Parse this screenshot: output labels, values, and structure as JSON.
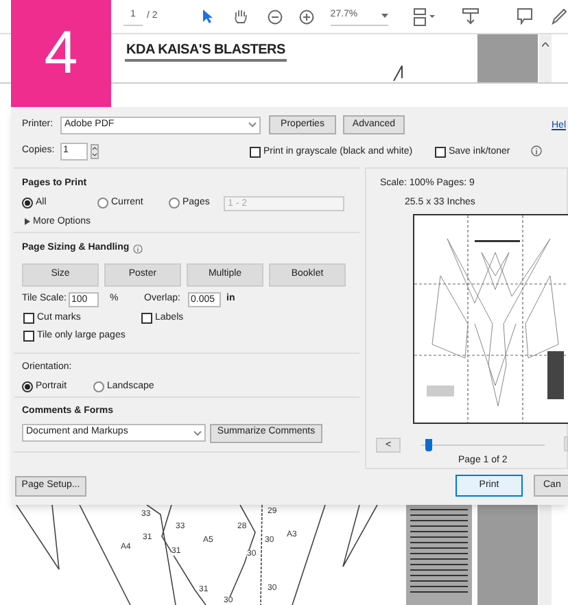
{
  "step_badge": "4",
  "toolbar": {
    "page": "1",
    "page_total": "/ 2",
    "zoom": "27.7%"
  },
  "document": {
    "title": "KDA KAISA'S BLASTERS",
    "labels": [
      {
        "text": "33"
      },
      {
        "text": "29"
      },
      {
        "text": "33"
      },
      {
        "text": "28"
      },
      {
        "text": "A4"
      },
      {
        "text": "31"
      },
      {
        "text": "A5"
      },
      {
        "text": "30"
      },
      {
        "text": "A3"
      },
      {
        "text": "31"
      },
      {
        "text": "30"
      },
      {
        "text": "31"
      },
      {
        "text": "30"
      },
      {
        "text": "30"
      }
    ]
  },
  "dialog": {
    "printer": {
      "label": "Printer:",
      "value": "Adobe PDF"
    },
    "top_buttons": [
      "Properties",
      "Advanced"
    ],
    "help_link": "Hel",
    "copies": {
      "label": "Copies:",
      "value": "1"
    },
    "options": [
      {
        "label": "Print in grayscale (black and white)",
        "checked": false
      },
      {
        "label": "Save ink/toner",
        "checked": false
      }
    ],
    "pages_to_print": {
      "heading": "Pages to Print",
      "choices": [
        {
          "label": "All",
          "selected": true
        },
        {
          "label": "Current",
          "selected": false
        },
        {
          "label": "Pages",
          "selected": false
        }
      ],
      "range": "1 - 2",
      "more_options": "More Options"
    },
    "page_sizing": {
      "heading": "Page Sizing & Handling",
      "modes": [
        "Size",
        "Poster",
        "Multiple",
        "Booklet"
      ],
      "tile_scale": {
        "label": "Tile Scale:",
        "value": "100",
        "unit": "%"
      },
      "overlap": {
        "label": "Overlap:",
        "value": "0.005",
        "unit": "in"
      },
      "checkboxes": [
        {
          "label": "Cut marks",
          "checked": false
        },
        {
          "label": "Labels",
          "checked": false
        },
        {
          "label": "Tile only large pages",
          "checked": false
        }
      ]
    },
    "orientation": {
      "heading": "Orientation:",
      "choices": [
        {
          "label": "Portrait",
          "selected": true
        },
        {
          "label": "Landscape",
          "selected": false
        }
      ]
    },
    "comments_forms": {
      "heading": "Comments & Forms",
      "value": "Document and Markups",
      "button": "Summarize Comments"
    },
    "page_setup": "Page Setup...",
    "preview": {
      "scale_info": "Scale: 100% Pages: 9",
      "paper_size": "25.5 x 33 Inches",
      "prev": "<",
      "level": 0.03,
      "page_label": "Page 1 of 2"
    },
    "buttons": [
      "Print",
      "Can"
    ]
  }
}
